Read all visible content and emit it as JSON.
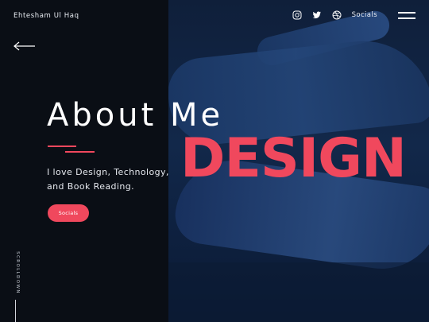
{
  "brand": {
    "name": "Ehtesham Ul Haq"
  },
  "nav": {
    "social_icons": [
      "instagram-icon",
      "twitter-icon",
      "dribbble-icon"
    ],
    "socials_label": "Socials",
    "menu_icon": "hamburger-menu-icon"
  },
  "hero": {
    "title": "About Me",
    "tagline_line1": "I love Design, Technology,",
    "tagline_line2": "and Book Reading.",
    "cta_label": "Socials",
    "background_word": "DESIGN"
  },
  "scroll": {
    "label": "SCROLLDOWN"
  },
  "colors": {
    "accent": "#f0485d",
    "left_panel": "#0a0e15",
    "right_panel": "#12284a",
    "text": "#ffffff"
  }
}
